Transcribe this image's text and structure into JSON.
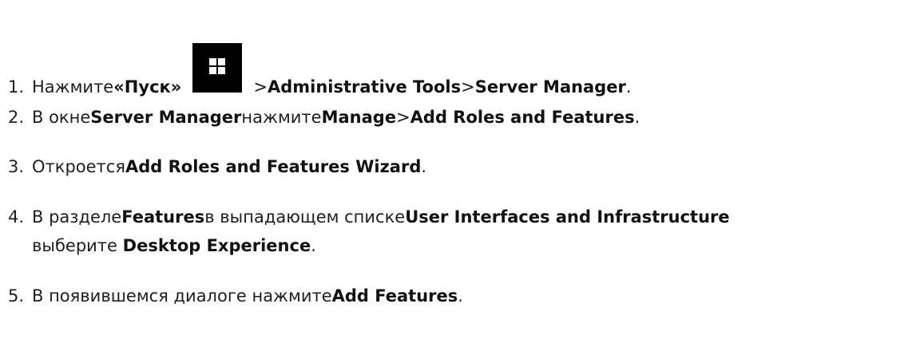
{
  "steps": [
    {
      "number": "1.",
      "parts": {
        "a": "Нажмите ",
        "b": "«Пуск»",
        "c": " > ",
        "d": "Administrative Tools",
        "e": " > ",
        "f": "Server Manager",
        "g": "."
      },
      "icon": "windows-start-icon"
    },
    {
      "number": "2.",
      "parts": {
        "a": "В окне ",
        "b": "Server Manager",
        "c": " нажмите ",
        "d": "Manage",
        "e": " > ",
        "f": "Add Roles and Features",
        "g": "."
      }
    },
    {
      "number": "3.",
      "parts": {
        "a": "Откроется ",
        "b": "Add Roles and Features Wizard",
        "c": "."
      }
    },
    {
      "number": "4.",
      "parts": {
        "a": "В разделе ",
        "b": "Features",
        "c": " в выпадающем списке ",
        "d": "User Interfaces and Infrastructure",
        "e": "выберите ",
        "f": "Desktop Experience",
        "g": "."
      }
    },
    {
      "number": "5.",
      "parts": {
        "a": "В появившемся диалоге нажмите ",
        "b": "Add Features",
        "c": "."
      }
    }
  ]
}
